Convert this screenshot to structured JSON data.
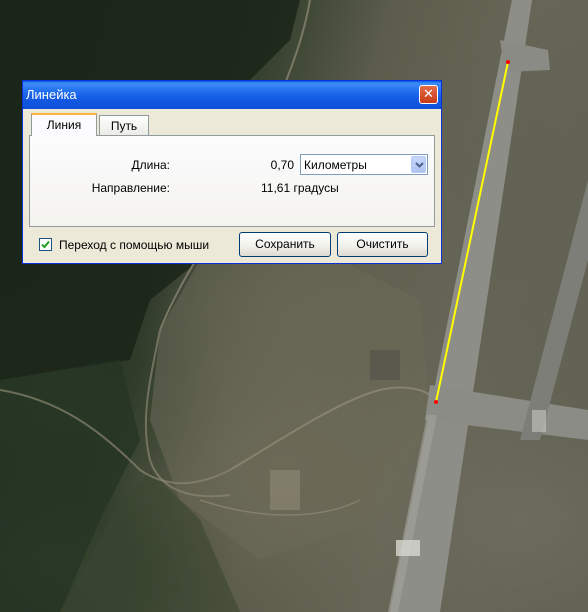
{
  "dialog": {
    "title": "Линейка",
    "close_glyph": "✕",
    "tabs": [
      {
        "label": "Линия",
        "active": true
      },
      {
        "label": "Путь",
        "active": false
      }
    ],
    "length_label": "Длина:",
    "length_value": "0,70",
    "unit_selected": "Километры",
    "direction_label": "Направление:",
    "direction_value": "11,61 градусы",
    "mouse_nav_label": "Переход с помощью мыши",
    "mouse_nav_checked": true,
    "save_label": "Сохранить",
    "clear_label": "Очистить"
  },
  "map": {
    "measure_line_color": "#ffff00",
    "endpoint_color": "#ff0000"
  },
  "colors": {
    "titlebar": "#0a58e6",
    "dialog_bg": "#ece9d8",
    "tab_accent": "#f9b43b"
  },
  "icons": {
    "close": "close-icon",
    "dropdown": "chevron-down-icon",
    "check": "checkmark-icon"
  }
}
